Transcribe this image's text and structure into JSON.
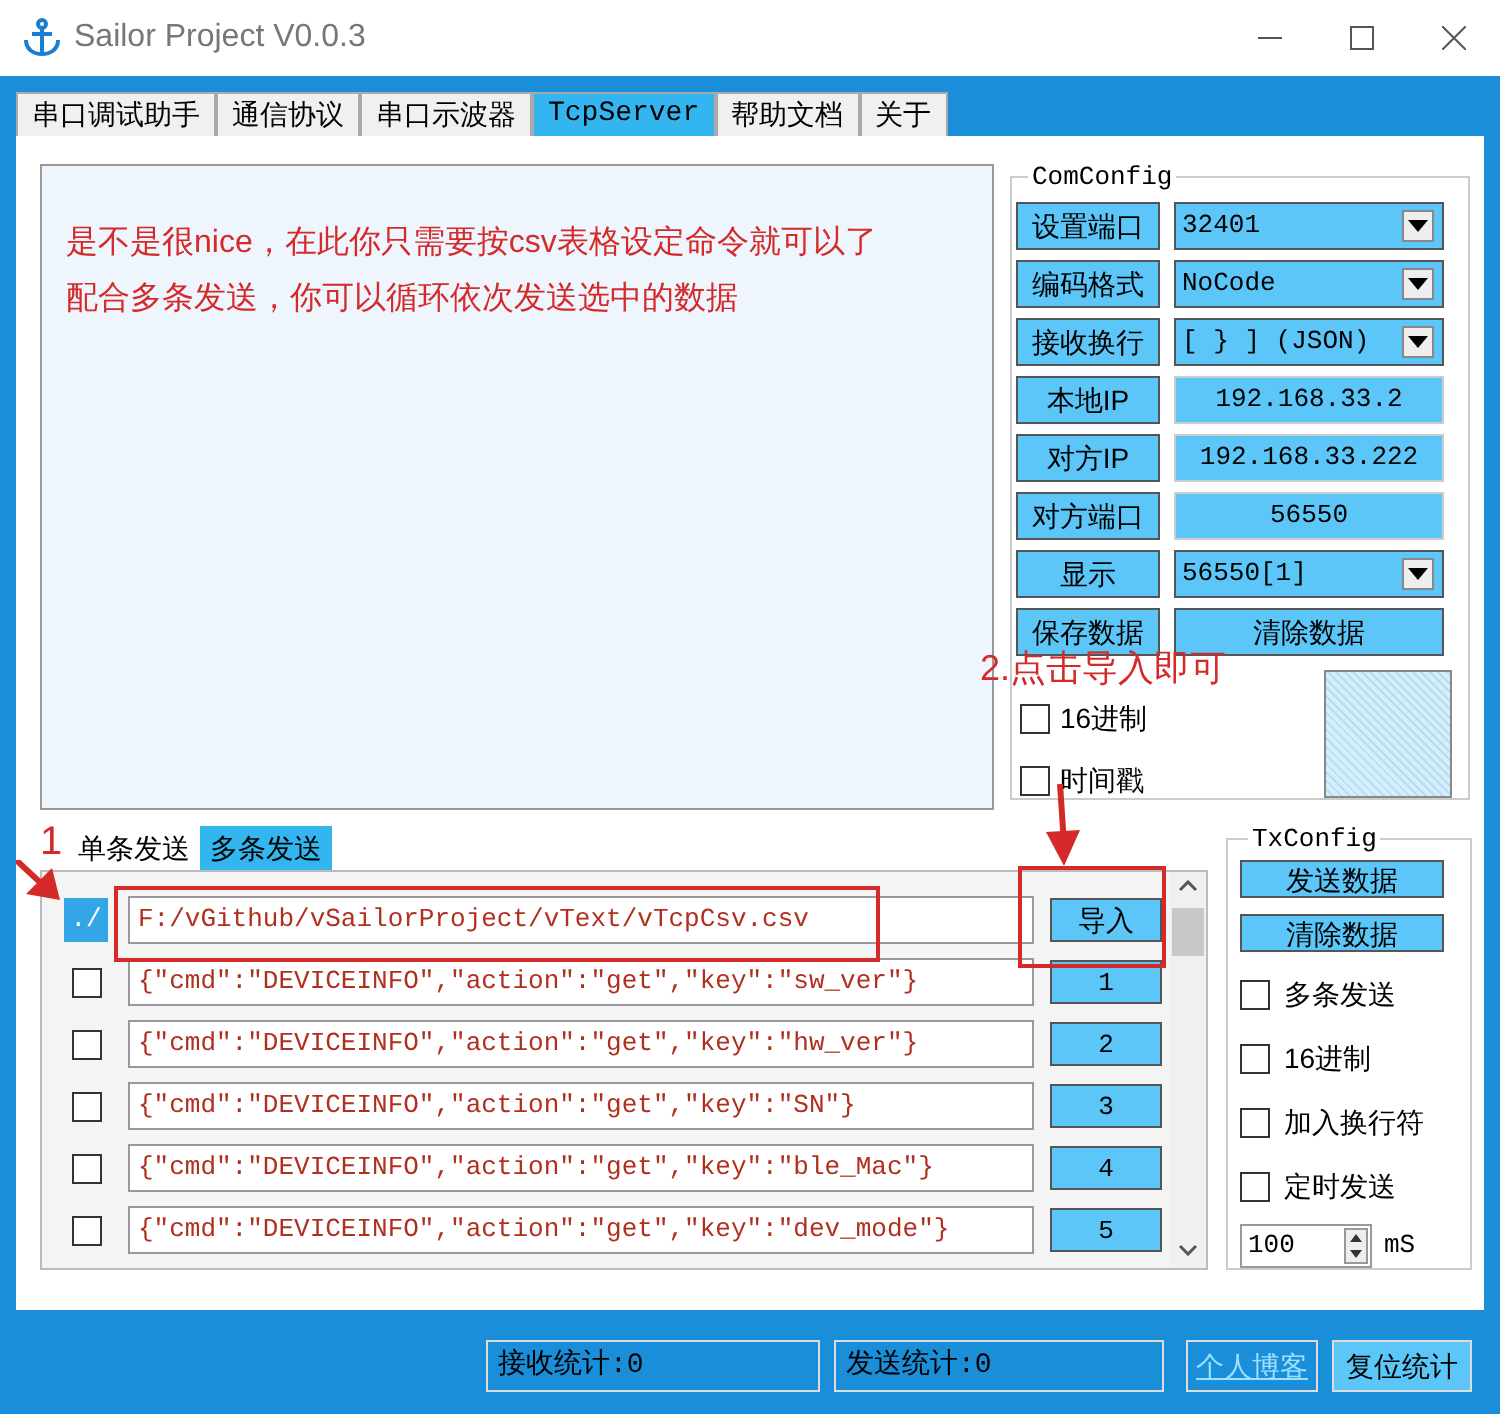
{
  "window": {
    "title": "Sailor Project V0.0.3"
  },
  "tabs": [
    {
      "label": "串口调试助手",
      "selected": false
    },
    {
      "label": "通信协议",
      "selected": false
    },
    {
      "label": "串口示波器",
      "selected": false
    },
    {
      "label": "TcpServer",
      "selected": true
    },
    {
      "label": "帮助文档",
      "selected": false
    },
    {
      "label": "关于",
      "selected": false
    }
  ],
  "com_config": {
    "title": "ComConfig",
    "rows": [
      {
        "label": "设置端口",
        "kind": "select",
        "value": "32401"
      },
      {
        "label": "编码格式",
        "kind": "select",
        "value": "NoCode"
      },
      {
        "label": "接收换行",
        "kind": "select",
        "value": "[ } ] (JSON)"
      },
      {
        "label": "本地IP",
        "kind": "value",
        "value": "192.168.33.2"
      },
      {
        "label": "对方IP",
        "kind": "value",
        "value": "192.168.33.222"
      },
      {
        "label": "对方端口",
        "kind": "value",
        "value": "56550"
      },
      {
        "label": "显示",
        "kind": "select",
        "value": "56550[1]"
      },
      {
        "label": "保存数据",
        "kind": "button",
        "value": "清除数据"
      }
    ],
    "checkboxes": [
      {
        "label": "16进制",
        "checked": false
      },
      {
        "label": "时间戳",
        "checked": false
      }
    ]
  },
  "send_tabs": [
    {
      "label": "单条发送",
      "selected": false
    },
    {
      "label": "多条发送",
      "selected": true
    }
  ],
  "multi_send": {
    "path_button": "./",
    "path": "F:/vGithub/vSailorProject/vText/vTcpCsv.csv",
    "import_button": "导入",
    "rows": [
      {
        "checked": false,
        "value": "{\"cmd\":\"DEVICEINFO\",\"action\":\"get\",\"key\":\"sw_ver\"}",
        "button": "1"
      },
      {
        "checked": false,
        "value": "{\"cmd\":\"DEVICEINFO\",\"action\":\"get\",\"key\":\"hw_ver\"}",
        "button": "2"
      },
      {
        "checked": false,
        "value": "{\"cmd\":\"DEVICEINFO\",\"action\":\"get\",\"key\":\"SN\"}",
        "button": "3"
      },
      {
        "checked": false,
        "value": "{\"cmd\":\"DEVICEINFO\",\"action\":\"get\",\"key\":\"ble_Mac\"}",
        "button": "4"
      },
      {
        "checked": false,
        "value": "{\"cmd\":\"DEVICEINFO\",\"action\":\"get\",\"key\":\"dev_mode\"}",
        "button": "5"
      }
    ]
  },
  "tx_config": {
    "title": "TxConfig",
    "buttons": [
      "发送数据",
      "清除数据"
    ],
    "checkboxes": [
      {
        "label": "多条发送",
        "checked": false
      },
      {
        "label": "16进制",
        "checked": false
      },
      {
        "label": "加入换行符",
        "checked": false
      },
      {
        "label": "定时发送",
        "checked": false
      }
    ],
    "interval": "100",
    "unit": "mS"
  },
  "status_bar": {
    "rx": "接收统计:0",
    "tx": "发送统计:0",
    "link": "个人博客",
    "reset": "复位统计"
  },
  "annotations": [
    "是不是很nice，在此你只需要按csv表格设定命令就可以了",
    "配合多条发送，你可以循环依次发送选中的数据",
    "2.点击导入即可",
    "1"
  ]
}
